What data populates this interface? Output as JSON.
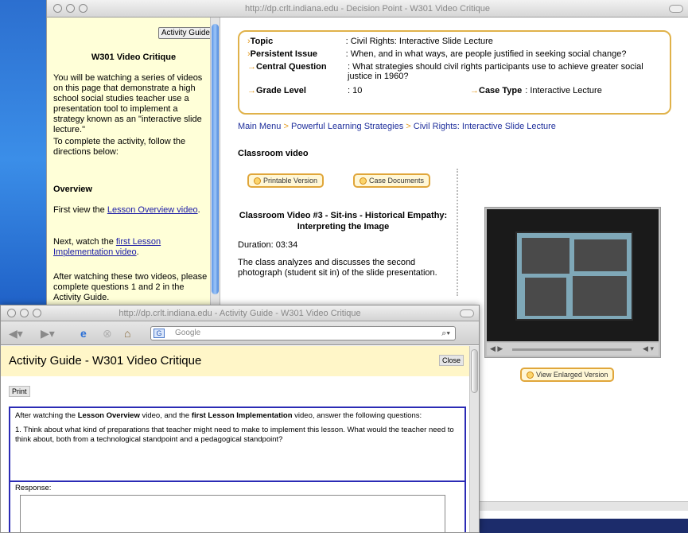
{
  "back_window": {
    "title": "http://dp.crlt.indiana.edu - Decision Point - W301 Video Critique",
    "side": {
      "activity_guide_button": "Activity Guide",
      "title": "W301 Video Critique",
      "intro": "You will be watching a series of videos on this page that demonstrate a high school social studies teacher use a presentation tool to implement a strategy known as an \"interactive slide lecture.\"",
      "directions": "To complete the activity, follow the directions below:",
      "overview_heading": "Overview",
      "first_view_prefix": "First view the ",
      "first_view_link": "Lesson Overview video",
      "first_view_suffix": ".",
      "next_prefix": "Next, watch the ",
      "next_link": "first Lesson Implementation video",
      "next_suffix": ".",
      "after": "After watching these two videos, please complete questions 1 and 2 in the Activity Guide."
    },
    "info": {
      "topic_label": "Topic",
      "topic_value": ": Civil Rights: Interactive Slide Lecture",
      "issue_label": "Persistent Issue",
      "issue_value": ": When, and in what ways, are people justified in seeking social change?",
      "question_label": "Central Question",
      "question_value": ": What strategies should civil rights participants use to achieve greater social justice in 1960?",
      "grade_label": "Grade Level",
      "grade_value": ": 10",
      "case_label": "Case Type",
      "case_value": ": Interactive Lecture"
    },
    "breadcrumb": {
      "items": [
        "Main Menu",
        "Powerful Learning Strategies",
        "Civil Rights: Interactive Slide Lecture"
      ],
      "separator": ">"
    },
    "section_heading": "Classroom video",
    "printable_button": "Printable Version",
    "case_docs_button": "Case Documents",
    "video_title": "Classroom Video #3 - Sit-ins - Historical Empathy: Interpreting the Image",
    "duration": "Duration: 03:34",
    "description": "The class analyzes and discusses the second photograph (student sit in) of the slide presentation.",
    "enlarged_button": "View Enlarged Version"
  },
  "front_window": {
    "title": "http://dp.crlt.indiana.edu - Activity Guide - W301 Video Critique",
    "search_placeholder": "Google",
    "heading": "Activity Guide - W301 Video Critique",
    "close_button": "Close",
    "print_button": "Print",
    "instruction": {
      "part1": "After watching the ",
      "bold1": "Lesson Overview",
      "part2": " video, and the ",
      "bold2": "first Lesson Implementation",
      "part3": " video, answer the following questions:"
    },
    "question1": "1.  Think about what kind of preparations that teacher might need to make to implement this lesson. What would the teacher need to think about, both from a technological standpoint and a pedagogical standpoint?",
    "response_label": "Response:"
  },
  "icons": [
    "back-arrow-icon",
    "forward-arrow-icon",
    "ie-icon",
    "stop-icon",
    "home-icon",
    "google-icon",
    "search-icon"
  ]
}
